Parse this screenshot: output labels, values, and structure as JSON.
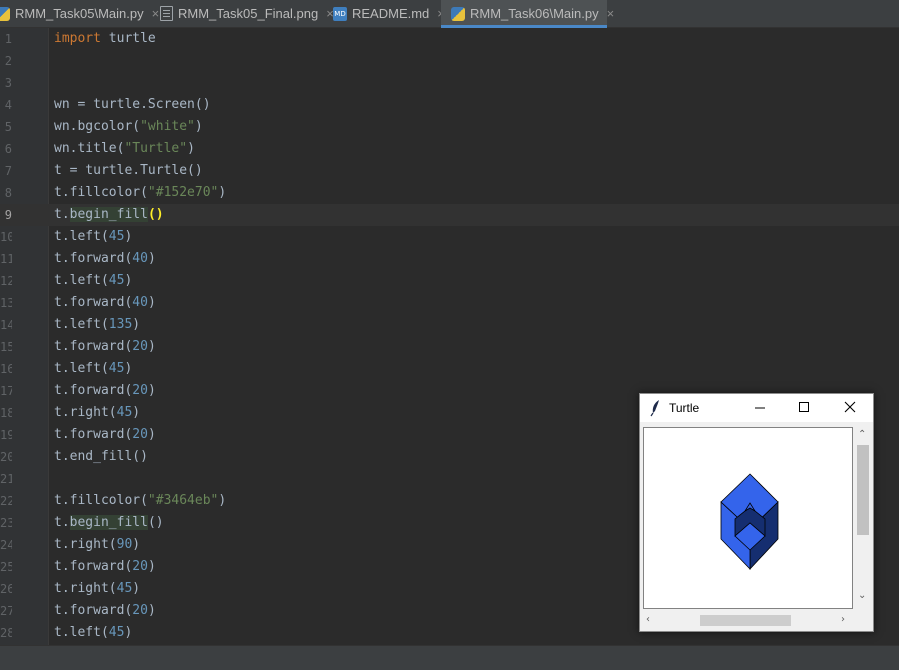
{
  "tabs": [
    {
      "label": "RMM_Task05\\Main.py",
      "icon": "python-file-icon"
    },
    {
      "label": "RMM_Task05_Final.png",
      "icon": "image-file-icon"
    },
    {
      "label": "README.md",
      "icon": "markdown-file-icon"
    },
    {
      "label": "RMM_Task06\\Main.py",
      "icon": "python-file-icon",
      "active": true
    }
  ],
  "tab_close": "×",
  "md_badge": "MD",
  "editor": {
    "line_numbers": [
      "1",
      "2",
      "3",
      "4",
      "5",
      "6",
      "7",
      "8",
      "9",
      "10",
      "11",
      "12",
      "13",
      "14",
      "15",
      "16",
      "17",
      "18",
      "19",
      "20",
      "21",
      "22",
      "23",
      "24",
      "25",
      "26",
      "27",
      "28"
    ],
    "current_line": 9,
    "lines": [
      "import turtle",
      "",
      "",
      "wn = turtle.Screen()",
      "wn.bgcolor(\"white\")",
      "wn.title(\"Turtle\")",
      "t = turtle.Turtle()",
      "t.fillcolor(\"#152e70\")",
      "t.begin_fill()",
      "t.left(45)",
      "t.forward(40)",
      "t.left(45)",
      "t.forward(40)",
      "t.left(135)",
      "t.forward(20)",
      "t.left(45)",
      "t.forward(20)",
      "t.right(45)",
      "t.forward(20)",
      "t.end_fill()",
      "",
      "t.fillcolor(\"#3464eb\")",
      "t.begin_fill()",
      "t.right(90)",
      "t.forward(20)",
      "t.right(45)",
      "t.forward(20)",
      "t.left(45)"
    ]
  },
  "turtle_window": {
    "title": "Turtle",
    "icon": "feather-icon",
    "fill_colors": [
      "#152e70",
      "#3464eb"
    ],
    "buttons": {
      "minimize": "minimize-icon",
      "maximize": "maximize-icon",
      "close": "close-icon"
    }
  },
  "colors": {
    "editor_bg": "#2b2b2b",
    "keyword": "#cc7832",
    "string": "#6a8759",
    "number": "#6897bb"
  }
}
